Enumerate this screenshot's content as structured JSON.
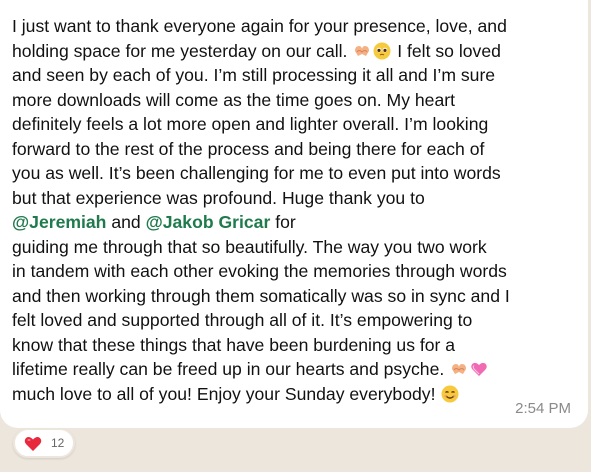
{
  "message": {
    "lines": [
      "I just want to thank everyone again for your presence, love, and",
      "holding space for me yesterday on our call.",
      "I felt so loved",
      "and seen by each of you. I’m still processing it all and I’m sure",
      "more downloads will come as the time goes on. My heart",
      "definitely feels a lot more open and lighter overall. I’m looking",
      "forward to the rest of the process and being there for each of",
      "you as well. It’s been challenging for me to even put into words",
      "but that experience was profound. Huge thank you to",
      "and",
      "for",
      "guiding me through that so beautifully. The way you two work",
      "in tandem with each other evoking the memories through words",
      "and then working through them somatically was so in sync and I",
      "felt loved and supported through all of it. It’s empowering to",
      "know that these things that have been burdening us for a",
      "lifetime really can be freed up in our hearts and psyche.",
      "much love to all of you! Enjoy your Sunday everybody!"
    ],
    "mentions": [
      "@Jeremiah",
      "@Jakob Gricar"
    ],
    "emojis": {
      "line2": [
        "heart-hands-emoji",
        "pleading-face-emoji"
      ],
      "line16": [
        "heart-hands-emoji",
        "pink-heart-emoji"
      ],
      "line17": [
        "smiling-face-emoji"
      ]
    },
    "mention_color": "#1f7a4c",
    "timestamp": "2:54 PM"
  },
  "reaction": {
    "icon": "red-heart-icon",
    "count": "12",
    "color": "#e8283c"
  },
  "colors": {
    "chat_background": "#ece6dd",
    "bubble": "#ffffff",
    "text": "#111111",
    "timestamp": "#8a8a8a"
  }
}
